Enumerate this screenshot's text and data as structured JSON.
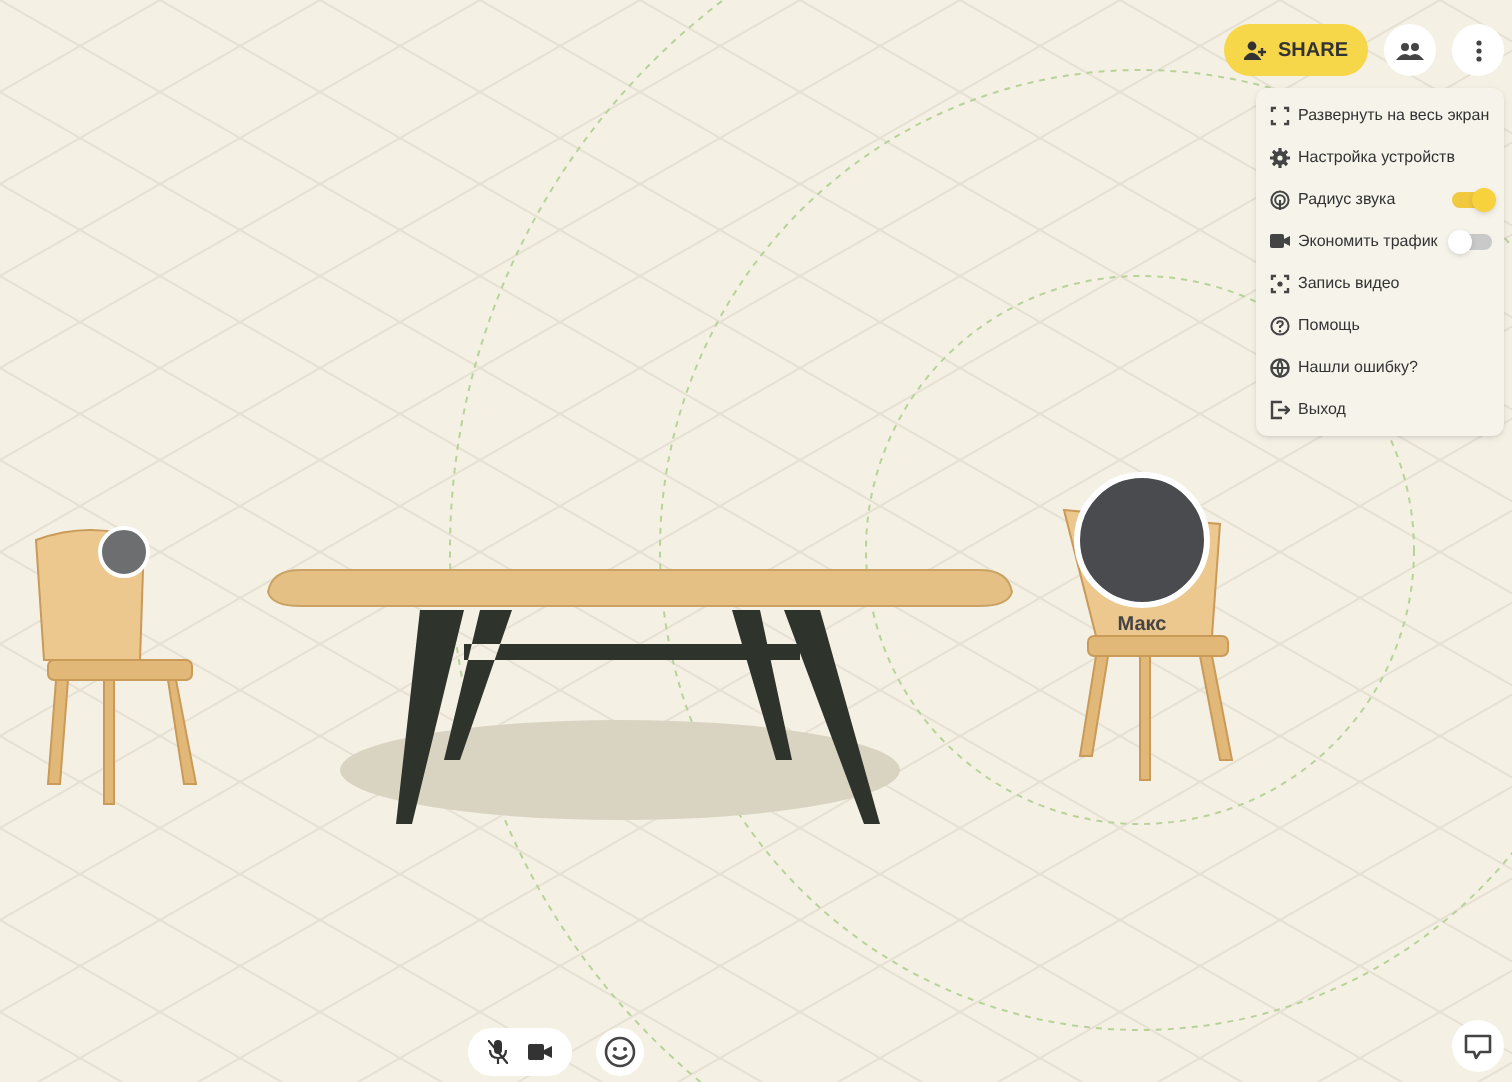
{
  "top_bar": {
    "share_button": "SHARE"
  },
  "menu": {
    "items": [
      {
        "kind": "action",
        "label": "Развернуть на весь экран"
      },
      {
        "kind": "action",
        "label": "Настройка устройств"
      },
      {
        "kind": "toggle",
        "label": "Радиус звука",
        "on": true
      },
      {
        "kind": "toggle",
        "label": "Экономить трафик",
        "on": false
      },
      {
        "kind": "action",
        "label": "Запись видео"
      },
      {
        "kind": "action",
        "label": "Помощь"
      },
      {
        "kind": "action",
        "label": "Нашли ошибку?"
      },
      {
        "kind": "action",
        "label": "Выход"
      }
    ]
  },
  "participants": [
    {
      "name": "Макс"
    }
  ],
  "controls": {
    "mic_muted": true
  }
}
